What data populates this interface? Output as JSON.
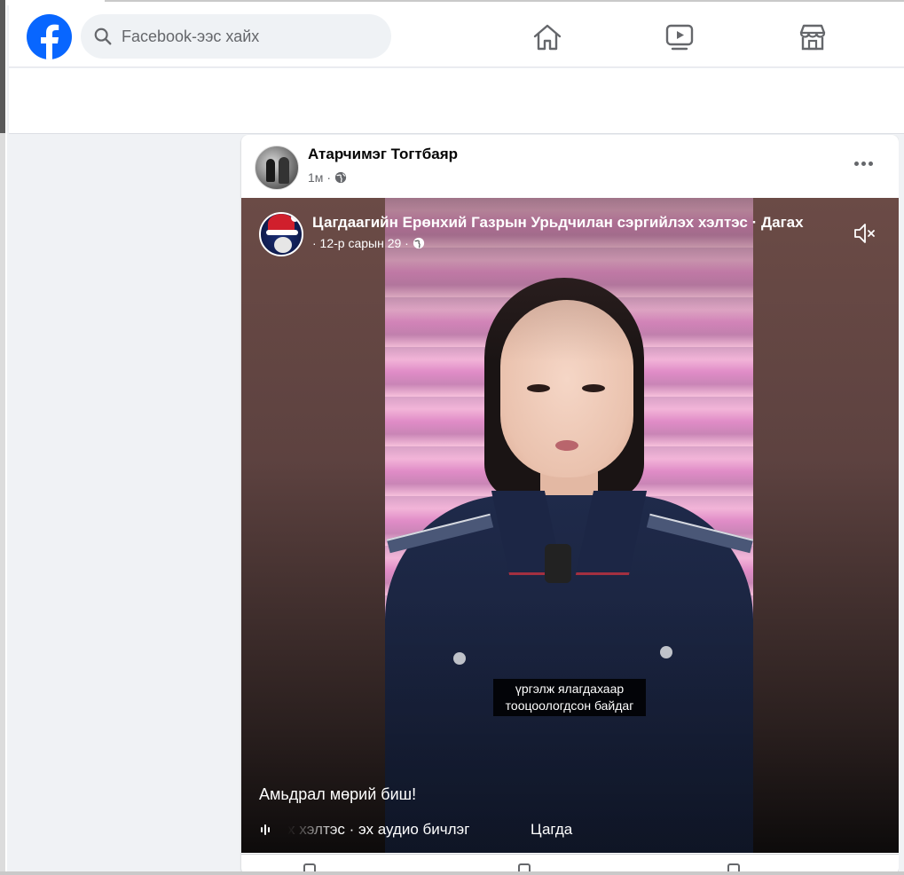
{
  "header": {
    "search_placeholder": "Facebook-ээс хайх",
    "nav": [
      "home-icon",
      "video-icon",
      "marketplace-icon"
    ],
    "brand_color": "#0866ff"
  },
  "post": {
    "author": "Атарчимэг Тогтбаяр",
    "time": "1м",
    "privacy_icon": "globe-icon",
    "more_icon": "more-options-icon"
  },
  "video": {
    "page_name": "Цагдаагийн Ерөнхий Газрын Урьдчилан сэргийлэх хэлтэс · Дагах",
    "date": "· 12-р сарын 29 ·",
    "caption_line1": "үргэлж ялагдахаар",
    "caption_line2": "тооцоологдсон байдаг",
    "overlay_text": "Амьдрал мөрий биш!",
    "audio_label": "х хэлтэс · эх аудио бичлэг",
    "audio_label_2": "Цагда",
    "mute_icon": "volume-muted-icon"
  }
}
